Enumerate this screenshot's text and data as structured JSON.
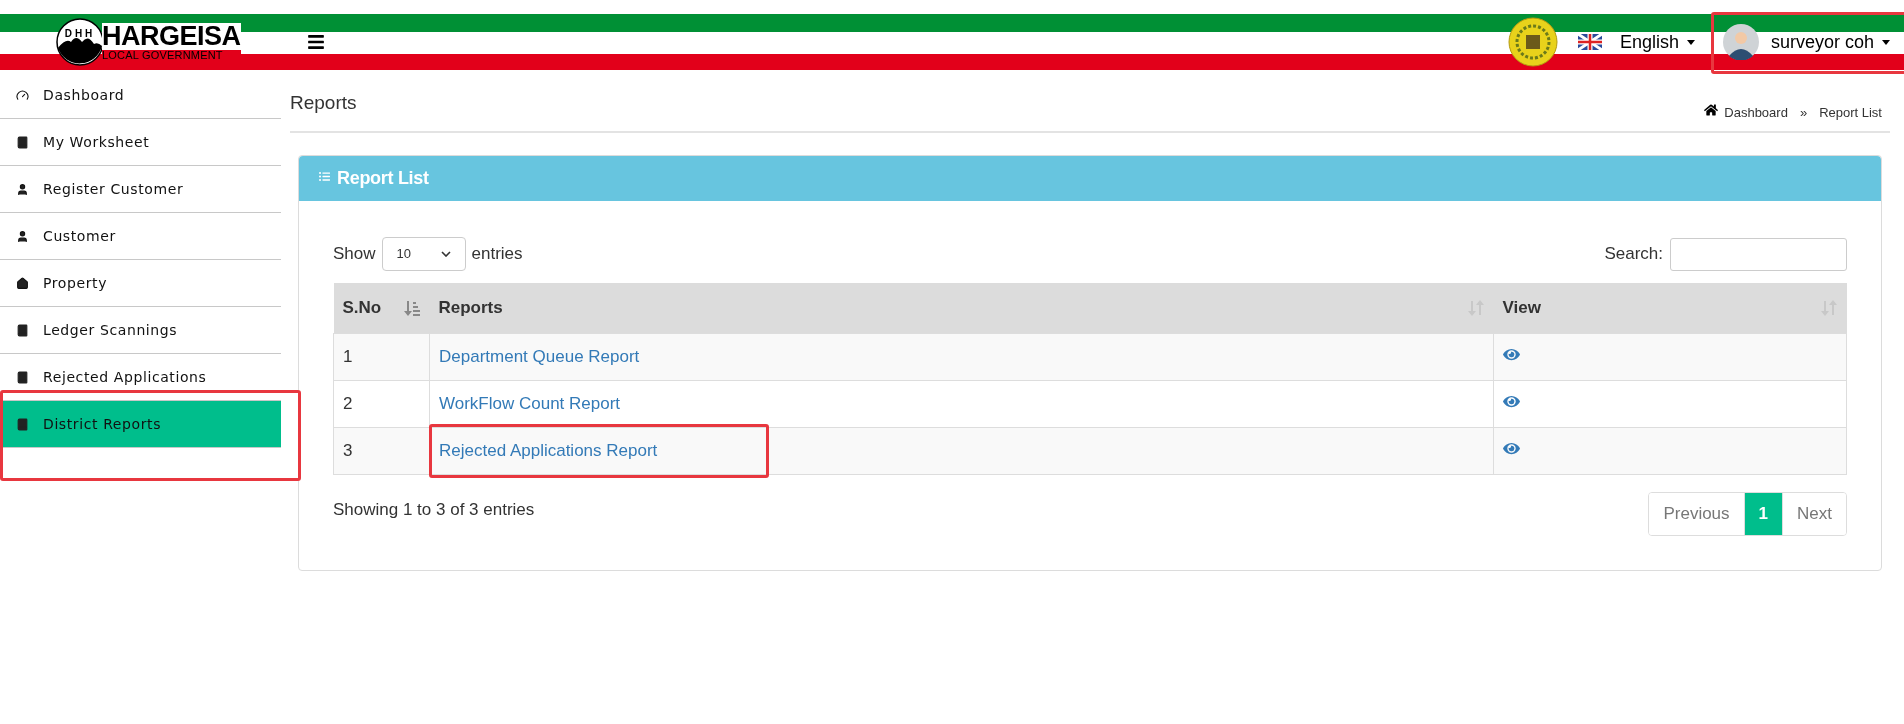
{
  "header": {
    "logo": {
      "mark": "DHH",
      "title": "HARGEISA",
      "subtitle": "LOCAL GOVERNMENT"
    },
    "language": "English",
    "user": {
      "name": "surveyor coh",
      "highlighted": true
    }
  },
  "sidebar": {
    "items": [
      {
        "label": "Dashboard",
        "kind": "gauge",
        "selected": false,
        "highlighted": false
      },
      {
        "label": "My Worksheet",
        "kind": "book",
        "selected": false,
        "highlighted": false
      },
      {
        "label": "Register Customer",
        "kind": "user",
        "selected": false,
        "highlighted": false
      },
      {
        "label": "Customer",
        "kind": "user",
        "selected": false,
        "highlighted": false
      },
      {
        "label": "Property",
        "kind": "home",
        "selected": false,
        "highlighted": false
      },
      {
        "label": "Ledger Scannings",
        "kind": "book",
        "selected": false,
        "highlighted": false
      },
      {
        "label": "Rejected Applications",
        "kind": "book",
        "selected": false,
        "highlighted": false
      },
      {
        "label": "District Reports",
        "kind": "book",
        "selected": true,
        "highlighted": true
      }
    ]
  },
  "page": {
    "title": "Reports",
    "breadcrumb": {
      "items": [
        "Dashboard",
        "Report List"
      ],
      "separator": "»"
    }
  },
  "card": {
    "title": "Report List",
    "length": {
      "before": "Show",
      "value": "10",
      "after": "entries"
    },
    "search": {
      "label": "Search:"
    },
    "table": {
      "columns": [
        {
          "label": "S.No",
          "kind": "sorted"
        },
        {
          "label": "Reports",
          "kind": "sortable"
        },
        {
          "label": "View",
          "kind": "sortable"
        }
      ],
      "rows": [
        {
          "sno": "1",
          "report": "Department Queue Report",
          "highlighted": false
        },
        {
          "sno": "2",
          "report": "WorkFlow Count Report",
          "highlighted": false
        },
        {
          "sno": "3",
          "report": "Rejected Applications Report",
          "highlighted": true
        }
      ]
    },
    "info": "Showing 1 to 3 of 3 entries",
    "pagination": [
      {
        "label": "Previous",
        "selected": false
      },
      {
        "label": "1",
        "selected": true
      },
      {
        "label": "Next",
        "selected": false
      }
    ]
  }
}
